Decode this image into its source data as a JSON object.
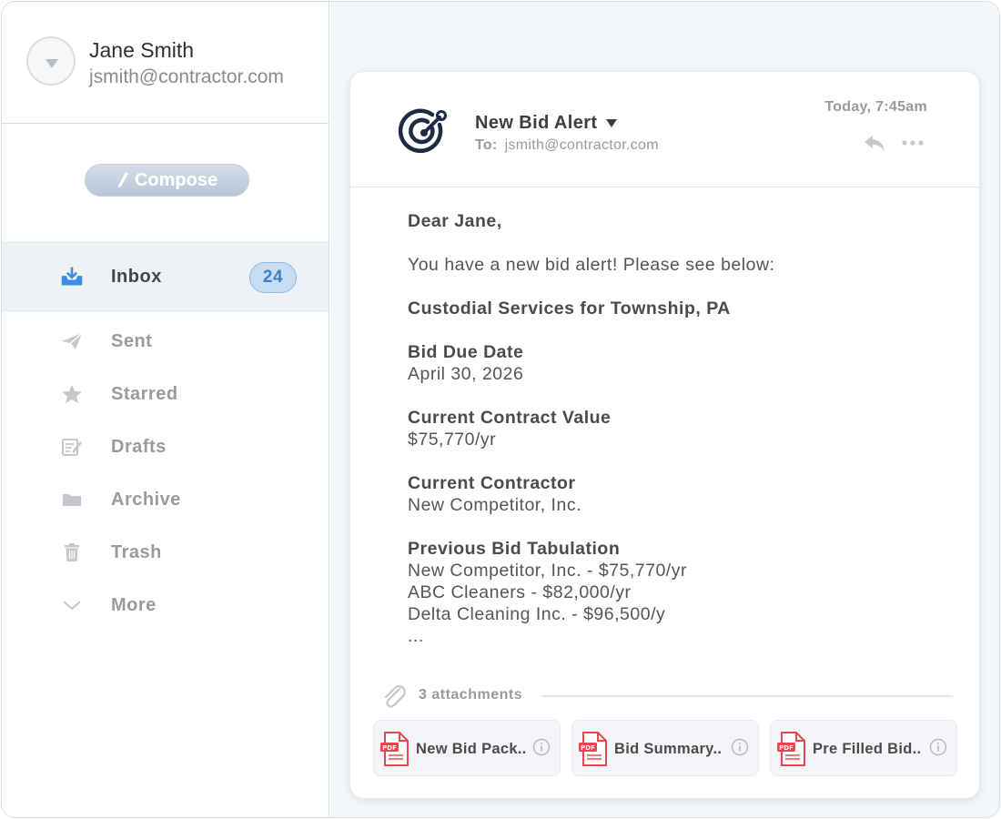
{
  "account": {
    "name": "Jane Smith",
    "email": "jsmith@contractor.com"
  },
  "compose": {
    "label": "Compose"
  },
  "nav": {
    "inbox": {
      "label": "Inbox",
      "count": "24",
      "icon": "inbox-download-icon"
    },
    "sent": {
      "label": "Sent",
      "icon": "paper-plane-icon"
    },
    "starred": {
      "label": "Starred",
      "icon": "star-icon"
    },
    "drafts": {
      "label": "Drafts",
      "icon": "edit-note-icon"
    },
    "archive": {
      "label": "Archive",
      "icon": "folder-icon"
    },
    "trash": {
      "label": "Trash",
      "icon": "trash-icon"
    },
    "more": {
      "label": "More",
      "icon": "chevron-down-icon"
    }
  },
  "email": {
    "subject": "New Bid Alert",
    "to_label": "To:",
    "to": "jsmith@contractor.com",
    "timestamp": "Today, 7:45am",
    "greeting": "Dear Jane,",
    "intro": "You have a new bid alert!  Please see below:",
    "project": "Custodial Services for Township, PA",
    "due_label": "Bid Due Date",
    "due_value": "April 30, 2026",
    "value_label": "Current Contract Value",
    "value_value": "$75,770/yr",
    "contractor_label": "Current Contractor",
    "contractor_value": "New Competitor, Inc.",
    "tab_label": "Previous Bid Tabulation",
    "tab_rows": [
      "New Competitor, Inc. - $75,770/yr",
      "ABC Cleaners - $82,000/yr",
      "Delta Cleaning Inc. - $96,500/y",
      "..."
    ]
  },
  "attachments": {
    "count_label": "3 attachments",
    "items": [
      {
        "name": "New Bid Pack..",
        "type": "PDF"
      },
      {
        "name": "Bid Summary..",
        "type": "PDF"
      },
      {
        "name": "Pre Filled Bid..",
        "type": "PDF"
      }
    ]
  },
  "colors": {
    "accent_blue": "#3f7fc5",
    "badge_bg": "#c8ddf4",
    "pdf_red": "#e5484d",
    "logo_navy": "#1f2a44"
  }
}
